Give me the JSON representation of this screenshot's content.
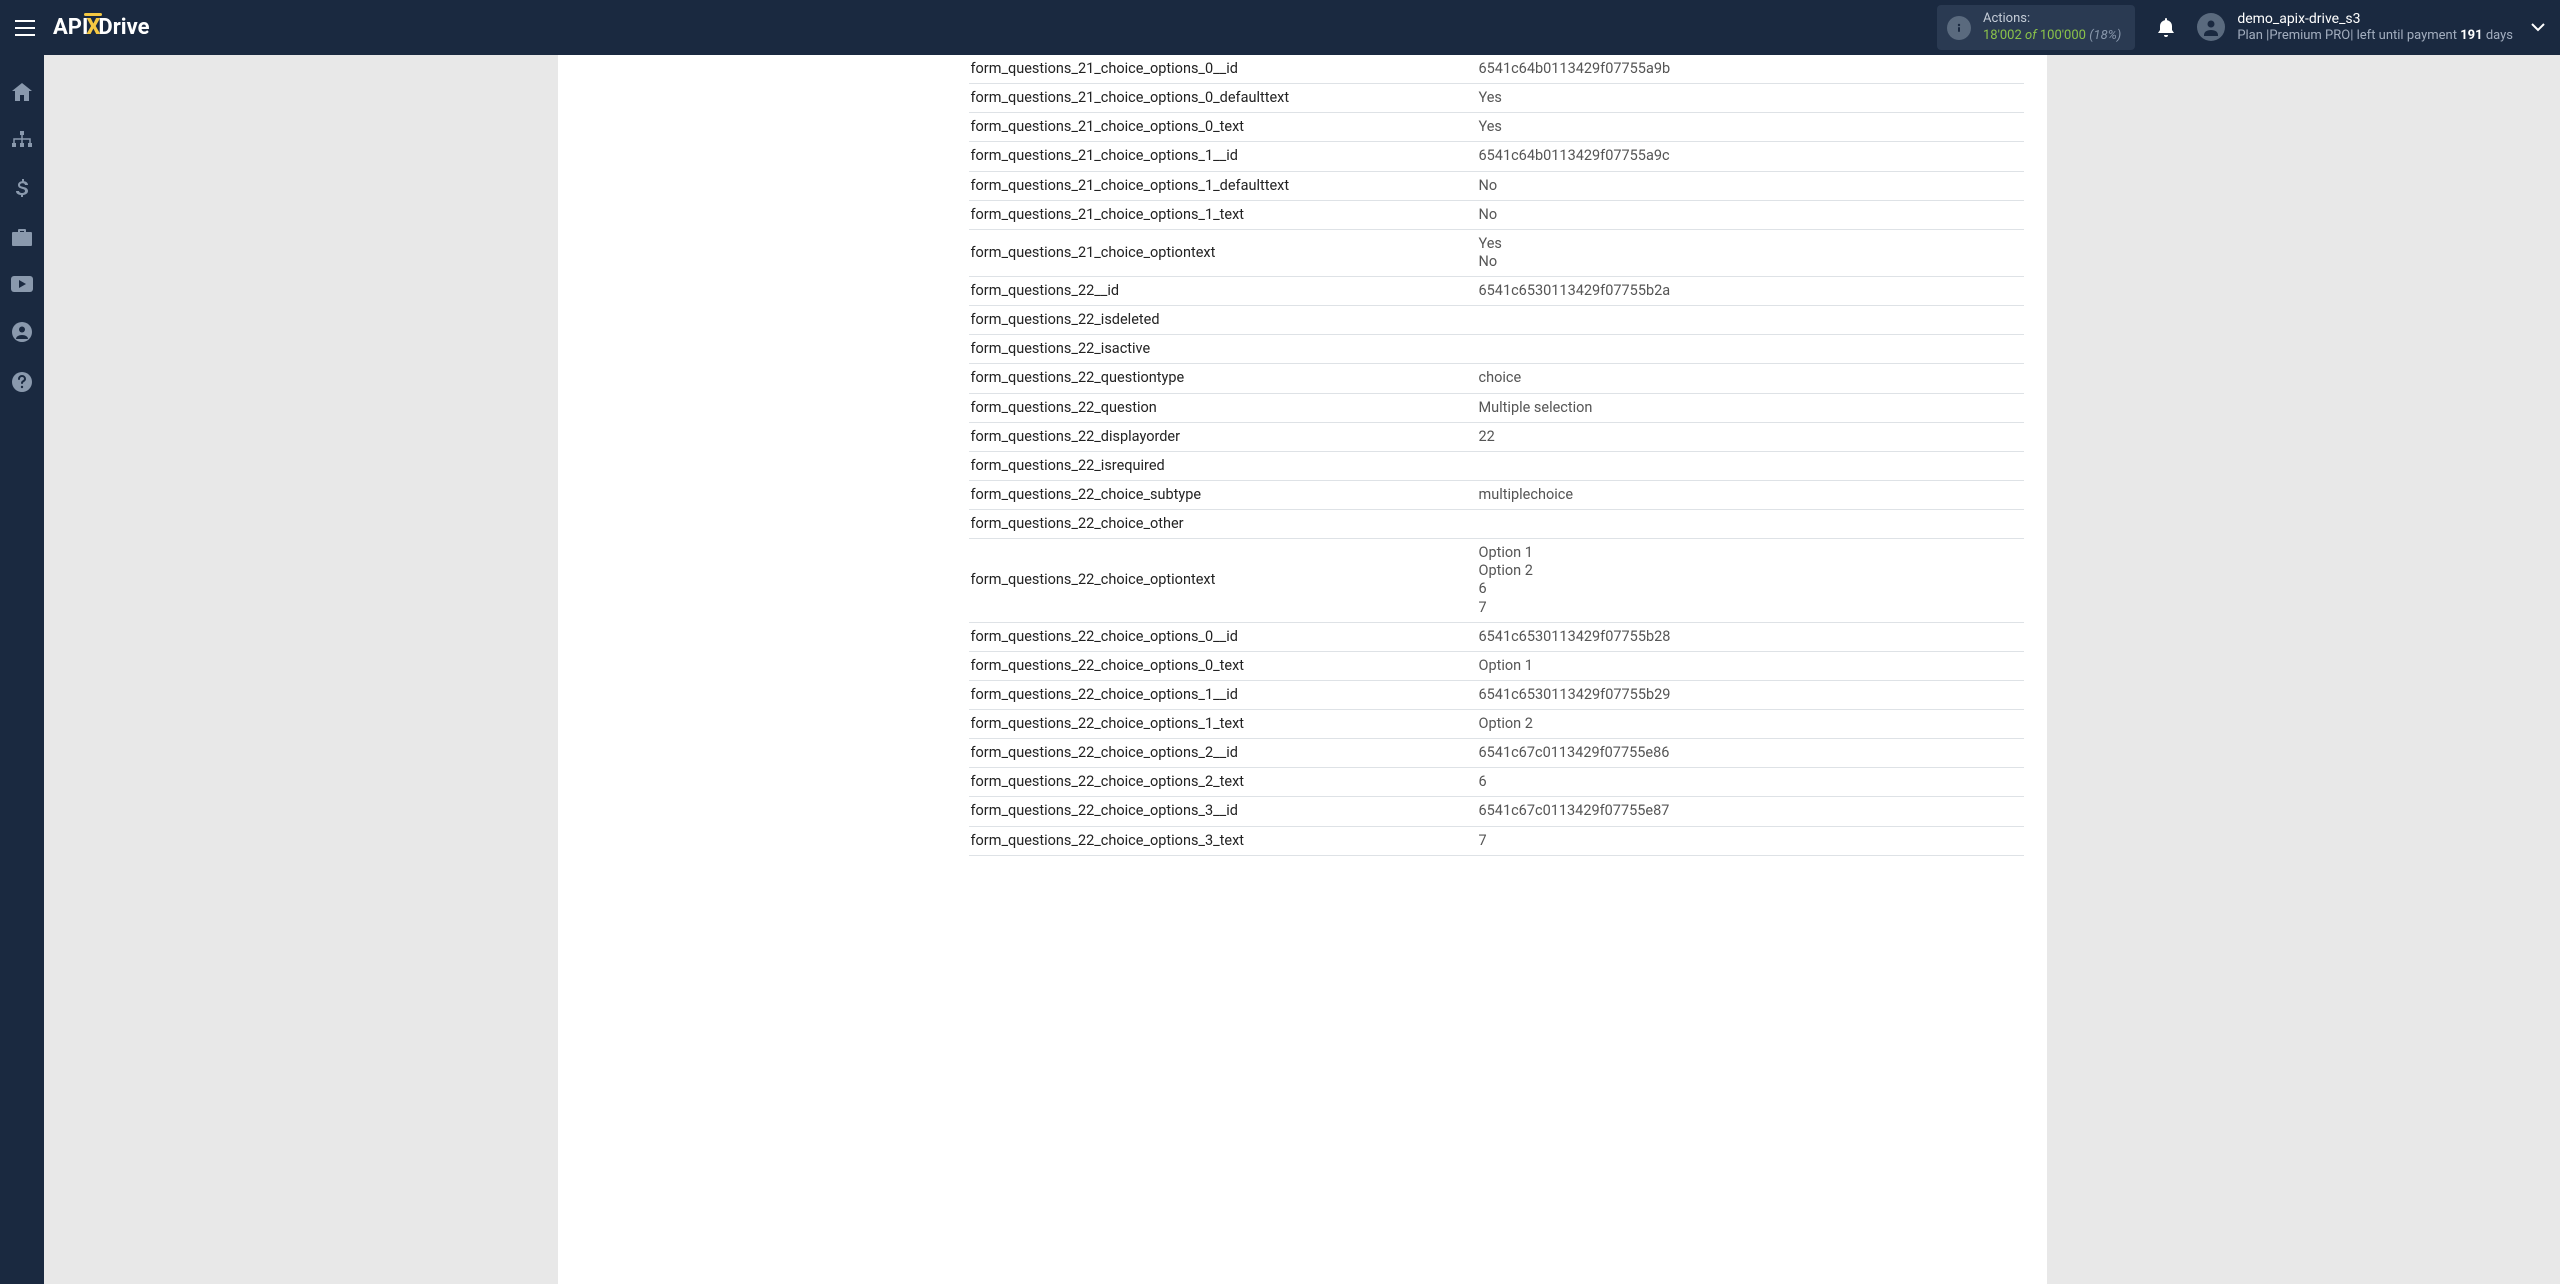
{
  "header": {
    "logo": {
      "api": "API",
      "x": "X",
      "drive": "Drive"
    },
    "actions": {
      "label": "Actions:",
      "used": "18'002",
      "of": "of",
      "total": "100'000",
      "pct": "(18%)"
    },
    "user": {
      "name": "demo_apix-drive_s3",
      "plan_prefix": "Plan |",
      "plan_name": "Premium PRO",
      "plan_mid": "| left until payment ",
      "plan_days_num": "191",
      "plan_days_word": " days"
    }
  },
  "rows": [
    {
      "k": "form_questions_21_choice_options_0__id",
      "v": "6541c64b0113429f07755a9b"
    },
    {
      "k": "form_questions_21_choice_options_0_defaulttext",
      "v": "Yes"
    },
    {
      "k": "form_questions_21_choice_options_0_text",
      "v": "Yes"
    },
    {
      "k": "form_questions_21_choice_options_1__id",
      "v": "6541c64b0113429f07755a9c"
    },
    {
      "k": "form_questions_21_choice_options_1_defaulttext",
      "v": "No"
    },
    {
      "k": "form_questions_21_choice_options_1_text",
      "v": "No"
    },
    {
      "k": "form_questions_21_choice_optiontext",
      "v": "Yes\nNo"
    },
    {
      "k": "form_questions_22__id",
      "v": "6541c6530113429f07755b2a"
    },
    {
      "k": "form_questions_22_isdeleted",
      "v": ""
    },
    {
      "k": "form_questions_22_isactive",
      "v": ""
    },
    {
      "k": "form_questions_22_questiontype",
      "v": "choice"
    },
    {
      "k": "form_questions_22_question",
      "v": "Multiple selection"
    },
    {
      "k": "form_questions_22_displayorder",
      "v": "22"
    },
    {
      "k": "form_questions_22_isrequired",
      "v": ""
    },
    {
      "k": "form_questions_22_choice_subtype",
      "v": "multiplechoice"
    },
    {
      "k": "form_questions_22_choice_other",
      "v": ""
    },
    {
      "k": "form_questions_22_choice_optiontext",
      "v": "Option 1\nOption 2\n6\n7"
    },
    {
      "k": "form_questions_22_choice_options_0__id",
      "v": "6541c6530113429f07755b28"
    },
    {
      "k": "form_questions_22_choice_options_0_text",
      "v": "Option 1"
    },
    {
      "k": "form_questions_22_choice_options_1__id",
      "v": "6541c6530113429f07755b29"
    },
    {
      "k": "form_questions_22_choice_options_1_text",
      "v": "Option 2"
    },
    {
      "k": "form_questions_22_choice_options_2__id",
      "v": "6541c67c0113429f07755e86"
    },
    {
      "k": "form_questions_22_choice_options_2_text",
      "v": "6"
    },
    {
      "k": "form_questions_22_choice_options_3__id",
      "v": "6541c67c0113429f07755e87"
    },
    {
      "k": "form_questions_22_choice_options_3_text",
      "v": "7"
    }
  ]
}
